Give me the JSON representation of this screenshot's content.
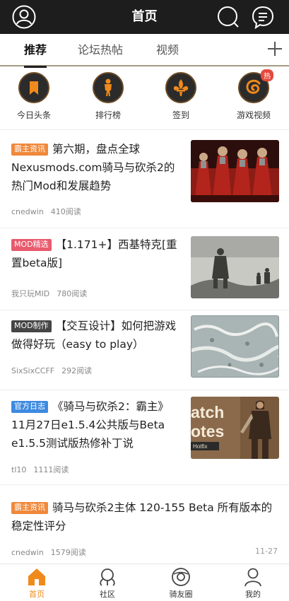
{
  "header": {
    "title": "首页",
    "icons": [
      "user-icon",
      "search-icon",
      "message-icon"
    ]
  },
  "tabs": [
    {
      "label": "推荐",
      "active": true
    },
    {
      "label": "论坛热帖",
      "active": false
    },
    {
      "label": "视频",
      "active": false
    }
  ],
  "quick_nav": [
    {
      "label": "今日头条",
      "icon": "bookmark-icon"
    },
    {
      "label": "排行榜",
      "icon": "warrior-icon"
    },
    {
      "label": "签到",
      "icon": "fleur-de-lis-icon"
    },
    {
      "label": "游戏视频",
      "icon": "swirl-icon",
      "badge": "热"
    }
  ],
  "articles": [
    {
      "tag": "霸主资讯",
      "tag_color": "#f0883a",
      "title": "第六期，盘点全球Nexusmods.com骑马与砍杀2的热门Mod和发展趋势",
      "author": "cnedwin",
      "reads": "410阅读",
      "thumb": "knights-image"
    },
    {
      "tag": "MOD精选",
      "tag_color": "#e95a6e",
      "title": "【1.171+】西基特克[重置beta版]",
      "author": "我只玩MID",
      "reads": "780阅读",
      "thumb": "battlefield-image"
    },
    {
      "tag": "MOD制作",
      "tag_color": "#454545",
      "title": "【交互设计】如何把游戏做得好玩（easy to play）",
      "author": "SixSixCCFF",
      "reads": "292阅读",
      "thumb": "map-image"
    },
    {
      "tag": "官方日志",
      "tag_color": "#3d8ae0",
      "title": "《骑马与砍杀2：霸主》11月27日e1.5.4公共版与Beta e1.5.5测试版热修补丁说",
      "author": "tl10",
      "reads": "1111阅读",
      "thumb": "patch-notes-image",
      "thumb_text": [
        "atch",
        "otes",
        "Hotfix"
      ]
    },
    {
      "tag": "霸主资讯",
      "tag_color": "#f0883a",
      "title": "骑马与砍杀2主体 120-155 Beta 所有版本的稳定性评分",
      "author": "cnedwin",
      "reads": "1579阅读",
      "date": "11-27"
    }
  ],
  "bottom_nav": [
    {
      "label": "首页",
      "icon": "home-icon",
      "active": true
    },
    {
      "label": "社区",
      "icon": "community-icon",
      "active": false
    },
    {
      "label": "骑友圈",
      "icon": "circle-icon",
      "active": false
    },
    {
      "label": "我的",
      "icon": "profile-icon",
      "active": false
    }
  ],
  "colors": {
    "accent": "#f08a1c",
    "header_bg": "#1d1d1d"
  }
}
